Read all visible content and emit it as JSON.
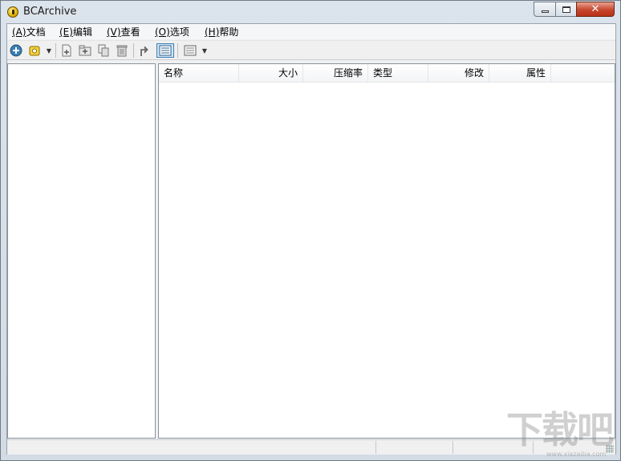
{
  "window": {
    "title": "BCArchive"
  },
  "menu": [
    {
      "mnemonic": "(A)",
      "label": "文档"
    },
    {
      "mnemonic": "(E)",
      "label": "编辑"
    },
    {
      "mnemonic": "(V)",
      "label": "查看"
    },
    {
      "mnemonic": "(O)",
      "label": "选项"
    },
    {
      "mnemonic": "(H)",
      "label": "帮助"
    }
  ],
  "toolbar": {
    "icons": [
      "new-archive-icon",
      "open-archive-icon",
      "add-file-icon",
      "add-folder-icon",
      "extract-icon",
      "delete-icon",
      "up-folder-icon",
      "details-view-icon",
      "view-options-icon"
    ]
  },
  "list": {
    "columns": [
      "名称",
      "大小",
      "压缩率",
      "类型",
      "修改",
      "属性"
    ]
  },
  "watermark": {
    "text": "下载吧",
    "sub": "www.xiazaiba.com"
  },
  "colors": {
    "close_button": "#c6452d",
    "accent": "#3c7fb1"
  }
}
